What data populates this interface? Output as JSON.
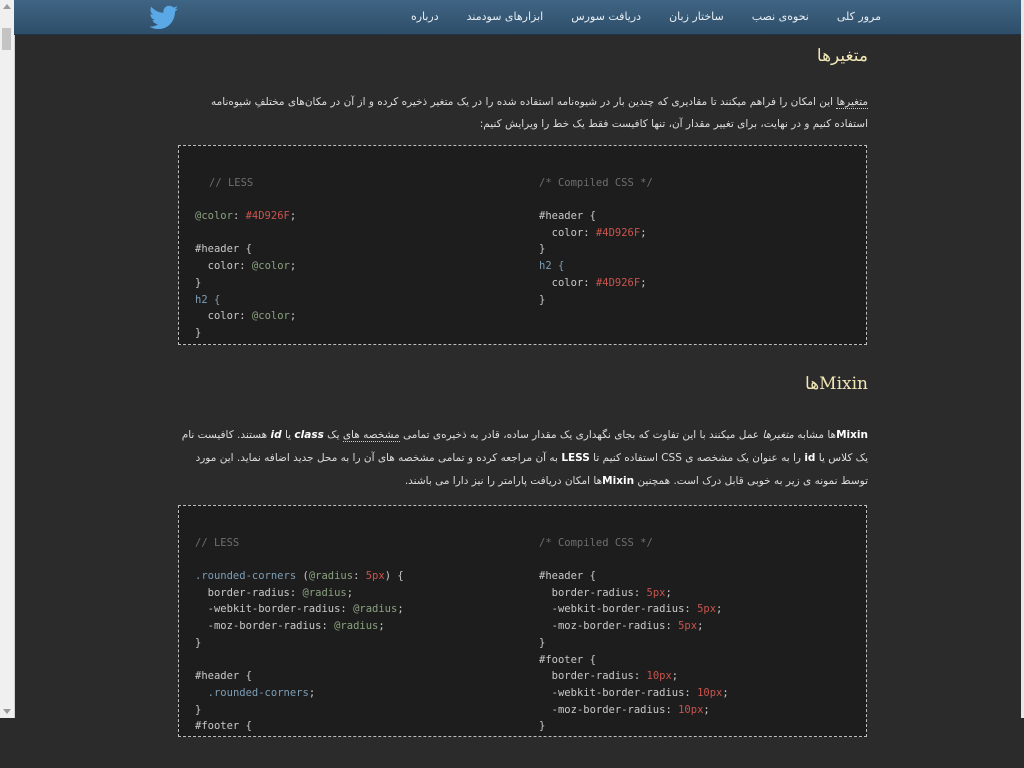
{
  "nav": {
    "items": [
      "مرور کلی",
      "نحوه‌ی نصب",
      "ساختار زبان",
      "دریافت سورس",
      "ابزارهای سودمند",
      "درباره"
    ]
  },
  "logo_icon": "twitter-bird-icon",
  "sections": {
    "variables": {
      "title": "متغیرها",
      "p_abbr": "متغیرها",
      "p_rest": " این امکان را فراهم میکنند تا مقادیری که چندین بار در شیوه‌نامه استفاده شده را در یک متغیر ذخیره کرده و از آن در مکان‌های مختلفِ شیوه‌نامه استفاده کنیم و در نهایت، برای تغییر مقدار آن، تنها کافیست فقط یک خط را ویرایش کنیم:"
    },
    "mixins": {
      "title": "Mixinها",
      "p_a": "Mixin",
      "p_b": "ها مشابه ",
      "p_c": "متغیرها",
      "p_d": " عمل میکنند با این تفاوت که بجای نگهداری یک مقدار ساده، قادر به ذخیره‌ی تمامی ",
      "p_e": "مشخصه های",
      "p_f": " یک ",
      "p_g": "class",
      "p_h": " یا ",
      "p_i": "id",
      "p_j": " هستند. کافیست نام یک کلاس یا ",
      "p_k": "id",
      "p_l": " را به عنوان یک مشخصه ی CSS استفاده کنیم تا ",
      "p_m": "LESS",
      "p_n": " به آن مراجعه کرده و تمامی مشخصه های آن را به محل جدید اضافه نماید. این مورد توسط نمونه ی زیر به خوبی قابل درک است. همچنین ",
      "p_o": "Mixin",
      "p_p": "ها امکان دریافت پارامتر را نیز دارا می باشند."
    }
  },
  "code1": {
    "left": {
      "comment": "// LESS",
      "decl_var": "@color",
      "decl_val": "#4D926F",
      "sel_header": "#header {",
      "prop1": "color",
      "use_var1": "@color",
      "close1": "}",
      "sel_h2": "h2 {",
      "prop2": "color",
      "use_var2": "@color",
      "close2": "}"
    },
    "right": {
      "comment": "/* Compiled CSS */",
      "sel_header": "#header {",
      "prop1": "color",
      "val1": "#4D926F",
      "close1": "}",
      "sel_h2": "h2 {",
      "prop2": "color",
      "val2": "#4D926F",
      "close2": "}"
    }
  },
  "code2": {
    "left": {
      "comment": "// LESS",
      "mixin_sel": ".rounded-corners",
      "param": "@radius",
      "param_default": "5px",
      "p1": "border-radius",
      "p2": "-webkit-border-radius",
      "p3": "-moz-border-radius",
      "v": "@radius",
      "close1": "}",
      "sel_header": "#header {",
      "mixin_call": ".rounded-corners",
      "close2": "}",
      "sel_footer": "#footer {"
    },
    "right": {
      "comment": "/* Compiled CSS */",
      "sel_header": "#header {",
      "p1": "border-radius",
      "p2": "-webkit-border-radius",
      "p3": "-moz-border-radius",
      "v_header": "5px",
      "close1": "}",
      "sel_footer": "#footer {",
      "v_footer": "10px",
      "close2": "}"
    }
  },
  "colors": {
    "header_bg": "#355a79",
    "title": "#f0e6b6",
    "code_bg": "#1d1d1d",
    "comment": "#6e6e6e",
    "variable": "#8aa17f",
    "value": "#c9544d"
  }
}
